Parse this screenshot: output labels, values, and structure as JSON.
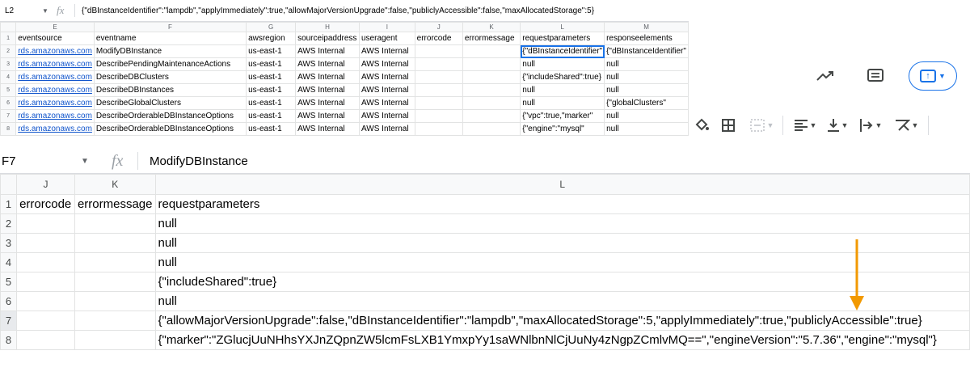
{
  "top_sheet": {
    "cell_ref": "L2",
    "formula": "{\"dBInstanceIdentifier\":\"lampdb\",\"applyImmediately\":true,\"allowMajorVersionUpgrade\":false,\"publiclyAccessible\":false,\"maxAllocatedStorage\":5}",
    "col_letters": [
      "E",
      "F",
      "G",
      "H",
      "I",
      "J",
      "K",
      "L",
      "M"
    ],
    "rows": [
      {
        "n": "1",
        "cells": [
          "eventsource",
          "eventname",
          "awsregion",
          "sourceipaddress",
          "useragent",
          "errorcode",
          "errormessage",
          "requestparameters",
          "responseelements"
        ]
      },
      {
        "n": "2",
        "cells": [
          "rds.amazonaws.com",
          "ModifyDBInstance",
          "us-east-1",
          "AWS Internal",
          "AWS Internal",
          "",
          "",
          "{\"dBInstanceIdentifier\"",
          "{\"dBInstanceIdentifier\""
        ]
      },
      {
        "n": "3",
        "cells": [
          "rds.amazonaws.com",
          "DescribePendingMaintenanceActions",
          "us-east-1",
          "AWS Internal",
          "AWS Internal",
          "",
          "",
          "null",
          "null"
        ]
      },
      {
        "n": "4",
        "cells": [
          "rds.amazonaws.com",
          "DescribeDBClusters",
          "us-east-1",
          "AWS Internal",
          "AWS Internal",
          "",
          "",
          "{\"includeShared\":true}",
          "null"
        ]
      },
      {
        "n": "5",
        "cells": [
          "rds.amazonaws.com",
          "DescribeDBInstances",
          "us-east-1",
          "AWS Internal",
          "AWS Internal",
          "",
          "",
          "null",
          "null"
        ]
      },
      {
        "n": "6",
        "cells": [
          "rds.amazonaws.com",
          "DescribeGlobalClusters",
          "us-east-1",
          "AWS Internal",
          "AWS Internal",
          "",
          "",
          "null",
          "{\"globalClusters\""
        ]
      },
      {
        "n": "7",
        "cells": [
          "rds.amazonaws.com",
          "DescribeOrderableDBInstanceOptions",
          "us-east-1",
          "AWS Internal",
          "AWS Internal",
          "",
          "",
          "{\"vpc\":true,\"marker\"",
          "null"
        ]
      },
      {
        "n": "8",
        "cells": [
          "rds.amazonaws.com",
          "DescribeOrderableDBInstanceOptions",
          "us-east-1",
          "AWS Internal",
          "AWS Internal",
          "",
          "",
          "{\"engine\":\"mysql\"",
          "null"
        ]
      }
    ]
  },
  "bottom_sheet": {
    "cell_ref": "F7",
    "formula": "ModifyDBInstance",
    "col_letters": [
      "J",
      "K",
      "L"
    ],
    "rows": [
      {
        "n": "1",
        "j": "errorcode",
        "k": "errormessage",
        "l": "requestparameters"
      },
      {
        "n": "2",
        "j": "",
        "k": "",
        "l": "null"
      },
      {
        "n": "3",
        "j": "",
        "k": "",
        "l": "null"
      },
      {
        "n": "4",
        "j": "",
        "k": "",
        "l": "null"
      },
      {
        "n": "5",
        "j": "",
        "k": "",
        "l": "{\"includeShared\":true}"
      },
      {
        "n": "6",
        "j": "",
        "k": "",
        "l": "null"
      },
      {
        "n": "7",
        "j": "",
        "k": "",
        "l": "{\"allowMajorVersionUpgrade\":false,\"dBInstanceIdentifier\":\"lampdb\",\"maxAllocatedStorage\":5,\"applyImmediately\":true,\"publiclyAccessible\":true}"
      },
      {
        "n": "8",
        "j": "",
        "k": "",
        "l": "{\"marker\":\"ZGlucjUuNHhsYXJnZQpnZW5lcmFsLXB1YmxpYy1saWNlbnNlCjUuNy4zNgpZCmlvMQ==\",\"engineVersion\":\"5.7.36\",\"engine\":\"mysql\"}"
      }
    ]
  },
  "toolbar": {
    "icons": [
      "explore-trend-icon",
      "comment-icon",
      "share-upload-icon",
      "fill-color-icon",
      "borders-icon",
      "merge-cells-icon",
      "horizontal-align-icon",
      "vertical-align-icon",
      "text-wrap-icon",
      "text-rotation-icon"
    ]
  },
  "colors": {
    "accent": "#1a73e8",
    "link": "#1155cc",
    "annotation_arrow": "#f29900"
  }
}
